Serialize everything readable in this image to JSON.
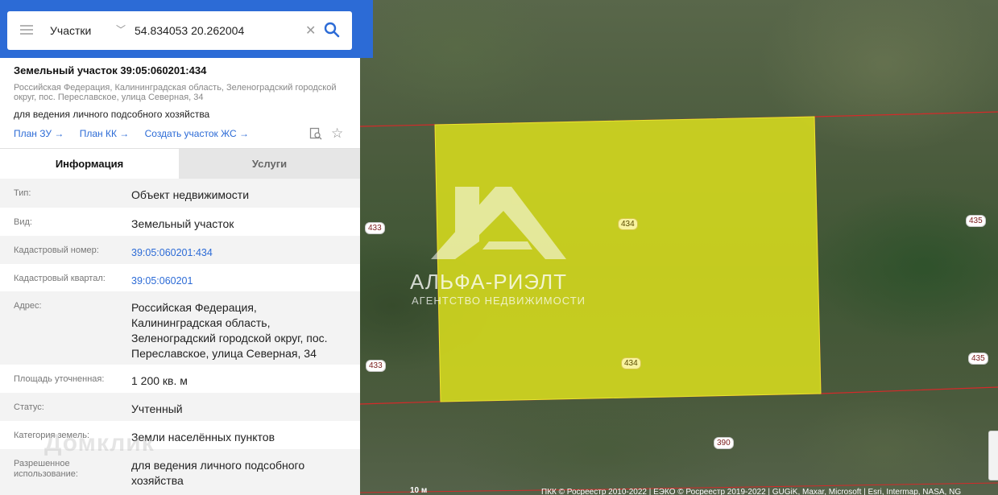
{
  "search": {
    "type_label": "Участки",
    "query": "54.834053 20.262004"
  },
  "parcel": {
    "title": "Земельный участок 39:05:060201:434",
    "address_short": "Российская Федерация, Калининградская область, Зеленоградский городской округ, пос. Переславское, улица Северная, 34",
    "usage": "для ведения личного подсобного хозяйства",
    "links": [
      "План ЗУ →",
      "План КК →",
      "Создать участок ЖС →"
    ]
  },
  "tabs": {
    "info": "Информация",
    "services": "Услуги"
  },
  "rows": [
    {
      "key": "Тип:",
      "value": "Объект недвижимости"
    },
    {
      "key": "Вид:",
      "value": "Земельный участок"
    },
    {
      "key": "Кадастровый номер:",
      "value": "39:05:060201:434"
    },
    {
      "key": "Кадастровый квартал:",
      "value": "39:05:060201"
    },
    {
      "key": "Адрес:",
      "value": "Российская Федерация, Калининградская область, Зеленоградский городской округ, пос. Переславское, улица Северная, 34"
    },
    {
      "key": "Площадь уточненная:",
      "value": "1 200 кв. м"
    },
    {
      "key": "Статус:",
      "value": "Учтенный"
    },
    {
      "key": "Категория земель:",
      "value": "Земли населённых пунктов"
    },
    {
      "key": "Разрешенное использование:",
      "value": "для ведения личного подсобного хозяйства"
    }
  ],
  "map": {
    "parcel_labels": [
      "434",
      "434"
    ],
    "neighbor_labels": [
      "433",
      "433",
      "435",
      "435",
      "390"
    ],
    "watermark": {
      "name": "АЛЬФА-РИЭЛТ",
      "sub": "АГЕНТСТВО НЕДВИЖИМОСТИ"
    },
    "scale": "10 м",
    "attribution": "ПКК © Росреестр 2010-2022 | ЕЭКО © Росреестр 2019-2022 | GUGiK, Maxar, Microsoft | Esri, Intermap, NASA, NG",
    "colors": {
      "parcel_fill": "#d7dc1e",
      "boundary": "#d42a2a",
      "accent": "#2c6bd6"
    }
  },
  "domclick_watermark": "Домклик"
}
